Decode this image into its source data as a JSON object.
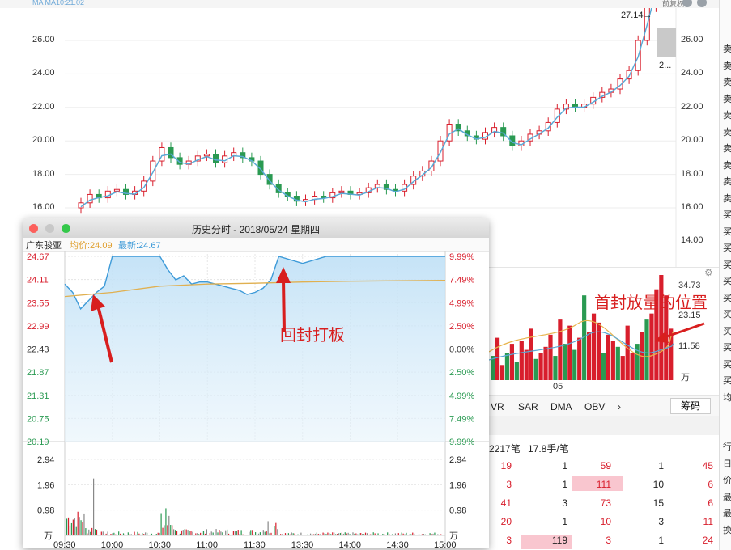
{
  "topbar": {
    "left_text": "MA  MA10:21.02",
    "right_text": "前复权"
  },
  "main_chart": {
    "y_ticks_left": [
      "26.00",
      "24.00",
      "22.00",
      "20.00",
      "18.00",
      "16.00"
    ],
    "y_ticks_right": [
      "26.00",
      "24.00",
      "22.00",
      "20.00",
      "18.00",
      "16.00",
      "14.00"
    ],
    "max_label": "27.14→",
    "small_label": "2..."
  },
  "volume_panel": {
    "y_ticks": [
      "34.73",
      "23.15",
      "11.58"
    ],
    "unit": "万",
    "x_label": "05",
    "annotation": "首封放量的位置"
  },
  "indicator_tabs": [
    "VR",
    "SAR",
    "DMA",
    "OBV"
  ],
  "indicator_more": "›",
  "chip_button": "筹码",
  "trades": {
    "header_count": "2217笔",
    "header_avg": "17.8手/笔",
    "rows": [
      [
        "19",
        "1",
        "59",
        "1",
        "45"
      ],
      [
        "3",
        "1",
        "111",
        "10",
        "6"
      ],
      [
        "41",
        "3",
        "73",
        "15",
        "6"
      ],
      [
        "20",
        "1",
        "10",
        "3",
        "11"
      ],
      [
        "3",
        "119",
        "3",
        "1",
        "24"
      ]
    ]
  },
  "right_strip_chars": [
    "卖",
    "卖",
    "卖",
    "卖",
    "卖",
    "卖",
    "卖",
    "卖",
    "卖",
    "卖",
    "买",
    "买",
    "买",
    "买",
    "买",
    "买",
    "买",
    "买",
    "买",
    "买",
    "买",
    "均",
    "",
    "",
    "行",
    "日",
    "价",
    "最",
    "最",
    "换"
  ],
  "window": {
    "title": "历史分时 - 2018/05/24 星期四",
    "stock_name": "广东骏亚",
    "avg_label": "均价:24.09",
    "latest_label": "最新:24.67",
    "annotation": "回封打板",
    "colors": {
      "price_line": "#3d9ad8",
      "avg_line": "#e0b050",
      "up": "#d81e2c",
      "down": "#2a9a52"
    }
  },
  "chart_data": [
    {
      "type": "line",
      "title": "历史分时 - 2018/05/24 星期四",
      "x_tick_labels": [
        "09:30",
        "10:00",
        "10:30",
        "11:00",
        "11:30",
        "13:30",
        "14:00",
        "14:30",
        "15:00"
      ],
      "y_left_ticks": [
        "24.67",
        "24.11",
        "23.55",
        "22.99",
        "22.43",
        "21.87",
        "21.31",
        "20.75",
        "20.19"
      ],
      "y_right_ticks": [
        "9.99%",
        "7.49%",
        "4.99%",
        "2.50%",
        "0.00%",
        "2.50%",
        "4.99%",
        "7.49%",
        "9.99%"
      ],
      "ylim": [
        20.19,
        24.67
      ],
      "reference_price": 22.43,
      "series": [
        {
          "name": "最新",
          "x": [
            "09:30",
            "09:35",
            "09:40",
            "09:45",
            "09:50",
            "09:55",
            "10:00",
            "10:05",
            "10:10",
            "10:15",
            "10:20",
            "10:25",
            "10:30",
            "10:35",
            "10:40",
            "10:45",
            "10:50",
            "10:55",
            "11:00",
            "11:05",
            "11:10",
            "11:15",
            "11:20",
            "11:25",
            "11:30",
            "13:05",
            "13:10",
            "13:15",
            "13:30",
            "13:45",
            "14:00",
            "14:15",
            "14:30",
            "14:45",
            "15:00"
          ],
          "values": [
            24.0,
            23.8,
            23.4,
            23.6,
            23.8,
            23.95,
            24.67,
            24.67,
            24.67,
            24.67,
            24.67,
            24.67,
            24.67,
            24.35,
            24.1,
            24.2,
            24.0,
            24.05,
            24.05,
            24.0,
            23.95,
            23.9,
            23.85,
            23.75,
            23.8,
            23.9,
            24.1,
            24.67,
            24.5,
            24.67,
            24.67,
            24.67,
            24.67,
            24.67,
            24.67
          ]
        },
        {
          "name": "均价",
          "x": [
            "09:30",
            "10:00",
            "10:30",
            "11:00",
            "11:30",
            "13:30",
            "14:00",
            "14:30",
            "15:00"
          ],
          "values": [
            23.7,
            23.8,
            23.95,
            24.0,
            24.02,
            24.05,
            24.07,
            24.08,
            24.09
          ]
        }
      ],
      "volume": {
        "y_ticks": [
          "2.94",
          "1.96",
          "0.98"
        ],
        "unit": "万",
        "ylim": [
          0,
          2.94
        ]
      }
    },
    {
      "type": "bar",
      "title": "",
      "y_ticks": [
        "34.73",
        "23.15",
        "11.58"
      ],
      "unit": "万",
      "ylim": [
        0,
        34.73
      ],
      "values": [
        8,
        14,
        5,
        9,
        12,
        6,
        13,
        10,
        17,
        7,
        9,
        11,
        15,
        8,
        20,
        12,
        18,
        10,
        14,
        28,
        16,
        22,
        19,
        9,
        15,
        13,
        11,
        8,
        18,
        9,
        12,
        16,
        20,
        22,
        30,
        34.73,
        28,
        17
      ],
      "directions": [
        "d",
        "u",
        "u",
        "d",
        "u",
        "d",
        "u",
        "u",
        "u",
        "d",
        "u",
        "u",
        "u",
        "d",
        "u",
        "d",
        "u",
        "d",
        "u",
        "d",
        "u",
        "u",
        "u",
        "d",
        "u",
        "u",
        "d",
        "u",
        "u",
        "u",
        "d",
        "u",
        "d",
        "u",
        "u",
        "u",
        "u",
        "u"
      ]
    }
  ]
}
